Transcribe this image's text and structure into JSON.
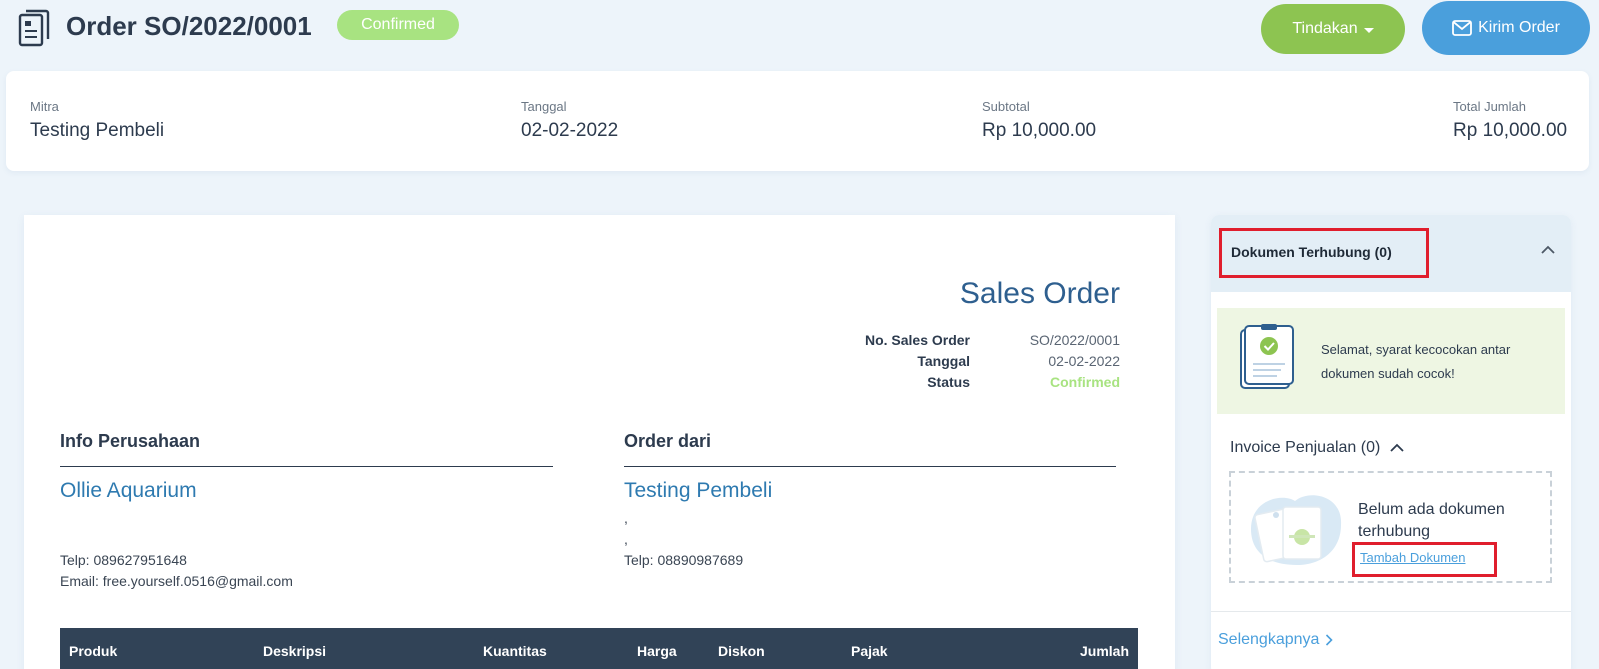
{
  "header": {
    "title": "Order SO/2022/0001",
    "status": "Confirmed",
    "actions_label": "Tindakan",
    "send_label": "Kirim Order"
  },
  "summary": {
    "partner_label": "Mitra",
    "partner": "Testing Pembeli",
    "date_label": "Tanggal",
    "date": "02-02-2022",
    "subtotal_label": "Subtotal",
    "subtotal": "Rp 10,000.00",
    "total_label": "Total Jumlah",
    "total": "Rp 10,000.00"
  },
  "document": {
    "heading": "Sales Order",
    "meta": [
      {
        "label": "No. Sales Order",
        "value": "SO/2022/0001"
      },
      {
        "label": "Tanggal",
        "value": "02-02-2022"
      },
      {
        "label": "Status",
        "value": "Confirmed"
      }
    ],
    "company": {
      "heading": "Info Perusahaan",
      "name": "Ollie Aquarium",
      "phone": "Telp: 089627951648",
      "email": "Email: free.yourself.0516@gmail.com"
    },
    "customer": {
      "heading": "Order dari",
      "name": "Testing Pembeli",
      "line1": ",",
      "line2": ",",
      "phone": "Telp: 08890987689"
    },
    "table_columns": [
      "Produk",
      "Deskripsi",
      "Kuantitas",
      "Harga",
      "Diskon",
      "Pajak",
      "Jumlah"
    ]
  },
  "sidebar": {
    "title": "Dokumen Terhubung (0)",
    "success_message": "Selamat, syarat kecocokan antar dokumen sudah cocok!",
    "invoice_heading": "Invoice Penjualan (0)",
    "empty_message": "Belum ada dokumen terhubung",
    "add_link": "Tambah Dokumen",
    "more_link": "Selengkapnya"
  },
  "colors": {
    "confirmed": "#a8e381",
    "actions_button": "#8dc451",
    "send_button": "#4a9fdc",
    "table_header": "#314357",
    "highlight": "#e01e2d"
  }
}
